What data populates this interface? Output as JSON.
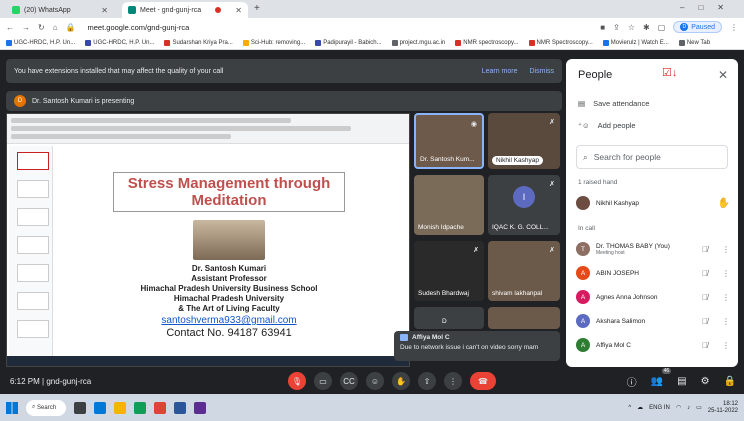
{
  "browser": {
    "tabs": [
      {
        "label": "(20) WhatsApp",
        "color": "#25d366"
      },
      {
        "label": "Meet - gnd-gunj-rca",
        "color": "#00897b"
      }
    ],
    "url": "meet.google.com/gnd-gunj-rca",
    "profile_status": "Paused",
    "profile_initial": "D",
    "bookmarks": [
      {
        "label": "UGC-HRDC, H.P. Un...",
        "color": "#1a73e8"
      },
      {
        "label": "UGC-HRDC, H.P. Un...",
        "color": "#3949ab"
      },
      {
        "label": "Sudarshan Kriya Pra...",
        "color": "#d93025"
      },
      {
        "label": "Sci-Hub: removing...",
        "color": "#f9ab00"
      },
      {
        "label": "Padipurayil - Babich...",
        "color": "#3949ab"
      },
      {
        "label": "project.mgu.ac.in",
        "color": "#5f6368"
      },
      {
        "label": "NMR spectroscopy...",
        "color": "#d93025"
      },
      {
        "label": "NMR Spectroscopy...",
        "color": "#d93025"
      },
      {
        "label": "Movierulz | Watch E...",
        "color": "#1a73e8"
      },
      {
        "label": "New Tab",
        "color": "#5f6368"
      }
    ]
  },
  "meet": {
    "extension_banner": "You have extensions installed that may affect the quality of your call",
    "learn_more": "Learn more",
    "dismiss": "Dismiss",
    "presenter_initial": "D",
    "presenting_text": "Dr. Santosh Kumari is presenting",
    "slide": {
      "title": "Stress Management through Meditation",
      "name": "Dr. Santosh Kumari",
      "role": "Assistant Professor",
      "org1": "Himachal Pradesh University Business School",
      "org2": "Himachal Pradesh University",
      "org3": "& The Art of Living Faculty",
      "email": "santoshverma933@gmail.com",
      "phone": "Contact No. 94187 63941"
    },
    "tiles": [
      {
        "name": "Dr. Santosh Kum..."
      },
      {
        "name": "Nikhil Kashyap"
      },
      {
        "name": "Monish Idpache"
      },
      {
        "name": "IQAC K. G. COLL...",
        "initial": "I"
      },
      {
        "name": "Sudesh Bhardwaj"
      },
      {
        "name": "shivam lakhanpal"
      },
      {
        "name": "D"
      },
      {
        "name": ""
      }
    ],
    "chat_toast": {
      "sender": "Affiya Mol C",
      "message": "Due to network issue i can't on video sorry mam"
    },
    "meeting_info": "6:12 PM | gnd-gunj-rca",
    "participant_count": "46"
  },
  "people": {
    "title": "People",
    "save_attendance": "Save attendance",
    "add_people": "Add people",
    "search_placeholder": "Search for people",
    "raised_hand_section": "1 raised hand",
    "raised": {
      "name": "Nikhil Kashyap"
    },
    "in_call_section": "In call",
    "list": [
      {
        "name": "Dr. THOMAS BABY (You)",
        "sub": "Meeting host",
        "initial": "T",
        "color": "#8d6e63"
      },
      {
        "name": "ABIN JOSEPH",
        "sub": "",
        "initial": "A",
        "color": "#e64a19"
      },
      {
        "name": "Agnes Anna Johnson",
        "sub": "",
        "initial": "A",
        "color": "#d81b60"
      },
      {
        "name": "Akshara Salimon",
        "sub": "",
        "initial": "A",
        "color": "#5c6bc0"
      },
      {
        "name": "Affiya Mol C",
        "sub": "",
        "initial": "A",
        "color": "#2e7d32"
      }
    ]
  },
  "taskbar": {
    "search": "Search",
    "lang": "ENG IN",
    "time": "18:12",
    "date": "25-11-2022"
  }
}
